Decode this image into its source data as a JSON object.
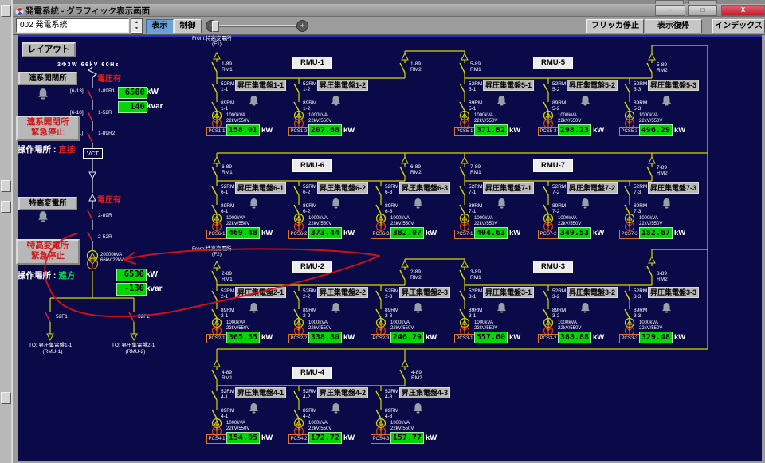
{
  "titlebar": {
    "title": "発電系統 - グラフィック表示画面",
    "minimize": "–",
    "restore": "□",
    "close": "X"
  },
  "toolbar": {
    "selector": "002 発電系統",
    "spin_up": "▲",
    "spin_down": "▼",
    "display": "表示",
    "control": "制御",
    "slider_minus": "−",
    "slider_plus": "+",
    "flicker_stop": "フリッカ停止",
    "restore_view": "表示復帰",
    "index": "インデックス"
  },
  "sidebar": {
    "layout": "レイアウト",
    "spec": "3Φ3W 66kV 60Hz",
    "renkei": {
      "name": "連系開閉所",
      "voltage": "電圧有",
      "switches": [
        {
          "tag": "[6-13]",
          "name": "1-89R1"
        },
        {
          "tag": "[6-10]",
          "name": "1-52R"
        },
        {
          "tag": "[6-11]",
          "name": "1-89R2"
        }
      ],
      "kw": "6500",
      "kw_unit": "kW",
      "kvar": "140",
      "kvar_unit": "kvar",
      "estop1": "連系開閉所",
      "estop2": "緊急停止",
      "oploc_label": "操作場所 :",
      "oploc": "直接"
    },
    "vct": "VCT",
    "tokko": {
      "name": "特高変電所",
      "voltage": "電圧有",
      "sw1": "2-89R",
      "sw2": "2-52R",
      "estop1": "特高変電所",
      "estop2": "緊急停止",
      "tx1": "20000kVA",
      "tx2": "66kV/22kV",
      "oploc_label": "操作場所 :",
      "oploc": "遠方",
      "kw": "6530",
      "kw_unit": "kW",
      "kvar": "-130",
      "kvar_unit": "kvar"
    },
    "feed1": {
      "sw": "52F1",
      "to1": "TO: 昇圧集電盤1-1",
      "to2": "(RMU-1)"
    },
    "feed2": {
      "sw": "52F2",
      "to1": "TO: 昇圧集電盤2-1",
      "to2": "(RMU-2)"
    }
  },
  "diagram": {
    "feed_f1": {
      "line1": "From:特高変電所",
      "line2": "(F1)"
    },
    "feed_f2": {
      "line1": "From:特高変電所",
      "line2": "(F2)"
    },
    "rmus": [
      {
        "name": "RMU-1"
      },
      {
        "name": "RMU-5"
      },
      {
        "name": "RMU-6"
      },
      {
        "name": "RMU-7"
      },
      {
        "name": "RMU-2"
      },
      {
        "name": "RMU-3"
      },
      {
        "name": "RMU-4"
      }
    ],
    "links": [
      {
        "l1": "1-89",
        "l2": "RM1"
      },
      {
        "l1": "1-89",
        "l2": "RM2"
      },
      {
        "l1": "5-89",
        "l2": "RM1"
      },
      {
        "l1": "5-89",
        "l2": "RM2"
      },
      {
        "l1": "6-89",
        "l2": "RM1"
      },
      {
        "l1": "6-89",
        "l2": "RM2"
      },
      {
        "l1": "7-89",
        "l2": "RM1"
      },
      {
        "l1": "7-89",
        "l2": "RM2"
      },
      {
        "l1": "2-89",
        "l2": "RM1"
      },
      {
        "l1": "2-89",
        "l2": "RM2"
      },
      {
        "l1": "3-89",
        "l2": "RM1"
      },
      {
        "l1": "3-89",
        "l2": "RM2"
      },
      {
        "l1": "4-89",
        "l2": "RM1"
      },
      {
        "l1": "4-89",
        "l2": "RM2"
      }
    ],
    "feeders": [
      {
        "sw52": "52RM",
        "sw89": "89RM",
        "no": "1-1",
        "panel": "昇圧集電盤1-1",
        "tx1": "1000kVA",
        "tx2": "22kV/550V",
        "pcs": "PCS1-1",
        "kw": "158.91",
        "unit": "kW"
      },
      {
        "sw52": "52RM",
        "sw89": "89RM",
        "no": "1-2",
        "panel": "昇圧集電盤1-2",
        "tx1": "1000kVA",
        "tx2": "22kV/550V",
        "pcs": "PCS1-2",
        "kw": "207.68",
        "unit": "kW"
      },
      {
        "sw52": "52RM",
        "sw89": "89RM",
        "no": "5-1",
        "panel": "昇圧集電盤5-1",
        "tx1": "1000kVA",
        "tx2": "22kV/550V",
        "pcs": "PCS5-1",
        "kw": "371.82",
        "unit": "kW"
      },
      {
        "sw52": "52RM",
        "sw89": "89RM",
        "no": "5-2",
        "panel": "昇圧集電盤5-2",
        "tx1": "1000kVA",
        "tx2": "22kV/550V",
        "pcs": "PCS5-2",
        "kw": "298.23",
        "unit": "kW"
      },
      {
        "sw52": "52RM",
        "sw89": "89RM",
        "no": "5-3",
        "panel": "昇圧集電盤5-3",
        "tx1": "1000kVA",
        "tx2": "22kV/550V",
        "pcs": "PCS5-3",
        "kw": "496.29",
        "unit": "kW"
      },
      {
        "sw52": "52RM",
        "sw89": "89RM",
        "no": "6-1",
        "panel": "昇圧集電盤6-1",
        "tx1": "1000kVA",
        "tx2": "22kV/550V",
        "pcs": "PCS6-1",
        "kw": "469.48",
        "unit": "kW"
      },
      {
        "sw52": "52RM",
        "sw89": "89RM",
        "no": "6-2",
        "panel": "昇圧集電盤6-2",
        "tx1": "1000kVA",
        "tx2": "22kV/550V",
        "pcs": "PCS6-2",
        "kw": "373.44",
        "unit": "kW"
      },
      {
        "sw52": "52RM",
        "sw89": "89RM",
        "no": "6-3",
        "panel": "昇圧集電盤6-3",
        "tx1": "1000kVA",
        "tx2": "22kV/550V",
        "pcs": "PCS6-3",
        "kw": "382.07",
        "unit": "kW"
      },
      {
        "sw52": "52RM",
        "sw89": "89RM",
        "no": "7-1",
        "panel": "昇圧集電盤7-1",
        "tx1": "1000kVA",
        "tx2": "22kV/550V",
        "pcs": "PCS7-1",
        "kw": "404.63",
        "unit": "kW"
      },
      {
        "sw52": "52RM",
        "sw89": "89RM",
        "no": "7-2",
        "panel": "昇圧集電盤7-2",
        "tx1": "1000kVA",
        "tx2": "22kV/550V",
        "pcs": "PCS7-2",
        "kw": "349.53",
        "unit": "kW"
      },
      {
        "sw52": "52RM",
        "sw89": "89RM",
        "no": "7-3",
        "panel": "昇圧集電盤7-3",
        "tx1": "1000kVA",
        "tx2": "22kV/550V",
        "pcs": "PCS7-3",
        "kw": "182.67",
        "unit": "kW"
      },
      {
        "sw52": "52RM",
        "sw89": "89RM",
        "no": "2-1",
        "panel": "昇圧集電盤2-1",
        "tx1": "1000kVA",
        "tx2": "22kV/550V",
        "pcs": "PCS2-1",
        "kw": "365.55",
        "unit": "kW"
      },
      {
        "sw52": "52RM",
        "sw89": "89RM",
        "no": "2-2",
        "panel": "昇圧集電盤2-2",
        "tx1": "1000kVA",
        "tx2": "22kV/550V",
        "pcs": "PCS2-2",
        "kw": "338.80",
        "unit": "kW"
      },
      {
        "sw52": "52RM",
        "sw89": "89RM",
        "no": "2-3",
        "panel": "昇圧集電盤2-3",
        "tx1": "1000kVA",
        "tx2": "22kV/550V",
        "pcs": "PCS2-3",
        "kw": "246.29",
        "unit": "kW"
      },
      {
        "sw52": "52RM",
        "sw89": "89RM",
        "no": "3-1",
        "panel": "昇圧集電盤3-1",
        "tx1": "1000kVA",
        "tx2": "22kV/550V",
        "pcs": "PCS3-1",
        "kw": "557.60",
        "unit": "kW"
      },
      {
        "sw52": "52RM",
        "sw89": "89RM",
        "no": "3-2",
        "panel": "昇圧集電盤3-2",
        "tx1": "1000kVA",
        "tx2": "22kV/550V",
        "pcs": "PCS3-2",
        "kw": "388.88",
        "unit": "kW"
      },
      {
        "sw52": "52RM",
        "sw89": "89RM",
        "no": "3-3",
        "panel": "昇圧集電盤3-3",
        "tx1": "1000kVA",
        "tx2": "22kV/550V",
        "pcs": "PCS3-3",
        "kw": "329.48",
        "unit": "kW"
      },
      {
        "sw52": "52RM",
        "sw89": "89RM",
        "no": "4-1",
        "panel": "昇圧集電盤4-1",
        "tx1": "1000kVA",
        "tx2": "22kV/550V",
        "pcs": "PCS4-1",
        "kw": "154.05",
        "unit": "kW"
      },
      {
        "sw52": "52RM",
        "sw89": "89RM",
        "no": "4-2",
        "panel": "昇圧集電盤4-2",
        "tx1": "1000kVA",
        "tx2": "22kV/550V",
        "pcs": "PCS4-2",
        "kw": "172.72",
        "unit": "kW"
      },
      {
        "sw52": "52RM",
        "sw89": "89RM",
        "no": "4-3",
        "panel": "昇圧集電盤4-3",
        "tx1": "1000kVA",
        "tx2": "22kV/550V",
        "pcs": "PCS4-3",
        "kw": "157.77",
        "unit": "kW"
      }
    ]
  },
  "colors": {
    "bus_yellow": "#d6d600",
    "alarm_green": "#00d800",
    "bg_navy": "#0a0a48",
    "annotation_red": "#dd1111"
  }
}
